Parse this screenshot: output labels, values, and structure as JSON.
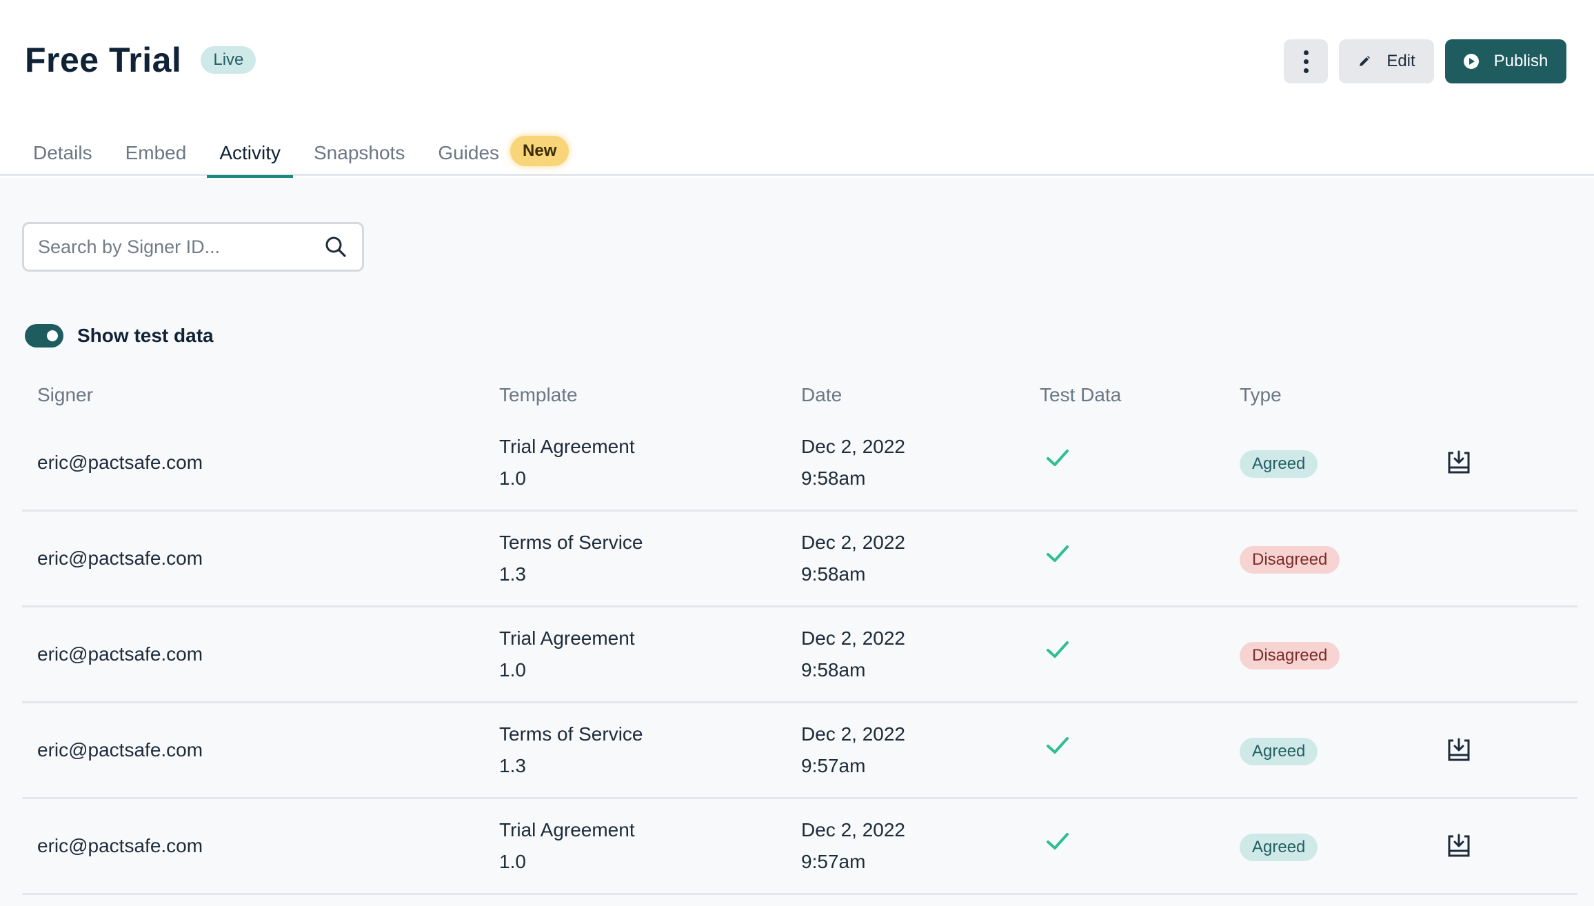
{
  "page": {
    "title": "Free Trial",
    "status_badge": "Live"
  },
  "actions": {
    "more_icon": "vertical-dots-icon",
    "edit_label": "Edit",
    "edit_icon": "pencil-icon",
    "publish_label": "Publish",
    "publish_icon": "play-circle-icon"
  },
  "tabs": [
    {
      "label": "Details",
      "active": false
    },
    {
      "label": "Embed",
      "active": false
    },
    {
      "label": "Activity",
      "active": true
    },
    {
      "label": "Snapshots",
      "active": false
    },
    {
      "label": "Guides",
      "active": false,
      "badge": "New"
    }
  ],
  "search": {
    "placeholder": "Search by Signer ID...",
    "value": ""
  },
  "toggle": {
    "label": "Show test data",
    "on": true
  },
  "table": {
    "columns": [
      "Signer",
      "Template",
      "Date",
      "Test Data",
      "Type"
    ],
    "rows": [
      {
        "signer": "eric@pactsafe.com",
        "template": "Trial Agreement",
        "version": "1.0",
        "date": "Dec 2, 2022",
        "time": "9:58am",
        "test": true,
        "type": "Agreed",
        "download": true
      },
      {
        "signer": "eric@pactsafe.com",
        "template": "Terms of Service",
        "version": "1.3",
        "date": "Dec 2, 2022",
        "time": "9:58am",
        "test": true,
        "type": "Disagreed",
        "download": false
      },
      {
        "signer": "eric@pactsafe.com",
        "template": "Trial Agreement",
        "version": "1.0",
        "date": "Dec 2, 2022",
        "time": "9:58am",
        "test": true,
        "type": "Disagreed",
        "download": false
      },
      {
        "signer": "eric@pactsafe.com",
        "template": "Terms of Service",
        "version": "1.3",
        "date": "Dec 2, 2022",
        "time": "9:57am",
        "test": true,
        "type": "Agreed",
        "download": true
      },
      {
        "signer": "eric@pactsafe.com",
        "template": "Trial Agreement",
        "version": "1.0",
        "date": "Dec 2, 2022",
        "time": "9:57am",
        "test": true,
        "type": "Agreed",
        "download": true
      }
    ]
  },
  "colors": {
    "accent": "#1e5c60",
    "tab_underline": "#1e8a7e",
    "check": "#2fbf8f",
    "agreed_bg": "#cfe9e8",
    "disagreed_bg": "#f7d3d1",
    "new_badge_bg": "#f9d57a"
  }
}
